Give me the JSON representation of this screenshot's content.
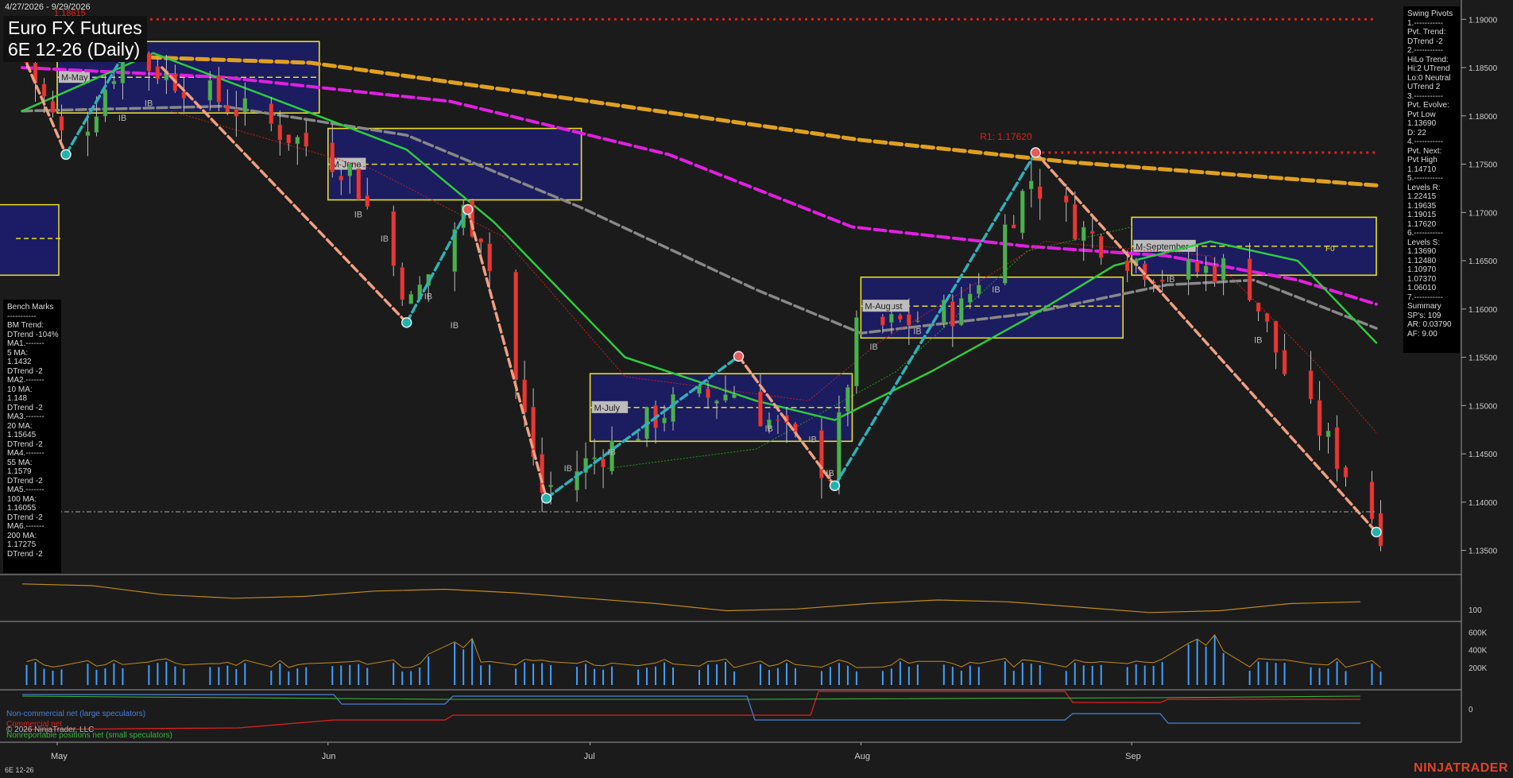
{
  "header": {
    "date_range": "4/27/2026 - 9/29/2026",
    "title": "Euro FX Futures",
    "subtitle": "6E 12-26 (Daily)",
    "old_level_label": "1.18615"
  },
  "bench_marks": [
    "Bench Marks",
    "-----------",
    "BM Trend:",
    "DTrend -104%",
    "MA1.-------",
    "5 MA:",
    "1.1432",
    "DTrend -2",
    "MA2.-------",
    "10 MA:",
    "1.148",
    "DTrend -2",
    "MA3.-------",
    "20 MA:",
    "1.15645",
    "DTrend -2",
    "MA4.-------",
    "55 MA:",
    "1.1579",
    "DTrend -2",
    "MA5.-------",
    "100 MA:",
    "1.16055",
    "DTrend -2",
    "MA6.-------",
    "200 MA:",
    "1.17275",
    "DTrend -2"
  ],
  "swing_pivots": [
    "Swing Pivots",
    "1.-----------",
    "Pvt. Trend:",
    "DTrend -2",
    "2.-----------",
    "HiLo Trend:",
    "Hi:2 UTrend",
    "Lo:0 Neutral",
    "UTrend 2",
    "3.-----------",
    "Pvt. Evolve:",
    "Pvt Low",
    "1.13690",
    "D: 22",
    "4.-----------",
    "Pvt. Next:",
    "Pvt High",
    "1.14710",
    "5.-----------",
    "Levels R:",
    "1.22415",
    "1.19635",
    "1.19015",
    "1.17620",
    "6.-----------",
    "Levels S:",
    "1.13690",
    "1.12480",
    "1.10970",
    "1.07370",
    "1.06010",
    "7.-----------",
    "Summary",
    "SP's: 109",
    "AR: 0.03790",
    "AF: 9.00"
  ],
  "legend": {
    "noncommercial": "Non-commercial net (large speculators)",
    "commercial": "Commercial net",
    "copyright": "© 2026 NinjaTrader, LLC",
    "nonreportable": "Nonreportable positions net (small speculators)"
  },
  "footer": {
    "symbol": "6E 12-26",
    "brand": "NINJATRADER"
  },
  "colors": {
    "background": "#1b1b1b",
    "up_candle": "#4caf50",
    "down_candle": "#e53935",
    "ma_fast": "#2ecc40",
    "ma_mid": "#888888",
    "ma_magenta": "#e020e0",
    "ma_slow": "#e0a020",
    "swing_up": "#30b0b8",
    "swing_down": "#f0a080",
    "resistance": "#e02020",
    "volume": "#3ea0ff",
    "noncommercial": "#4a7fd8",
    "commercial": "#e02020",
    "nonreportable": "#3cb43c"
  },
  "chart_data": {
    "type": "candlestick",
    "x_axis_labels": [
      "May",
      "Jun",
      "Jul",
      "Aug",
      "Sep"
    ],
    "x_axis_label_dates": [
      "2026-05-01",
      "2026-06-01",
      "2026-07-01",
      "2026-08-01",
      "2026-09-01"
    ],
    "date_start": "2026-04-27",
    "date_end": "2026-09-29",
    "price_axis": {
      "min": 1.1325,
      "max": 1.192,
      "ticks": [
        1.19,
        1.185,
        1.18,
        1.175,
        1.17,
        1.165,
        1.16,
        1.155,
        1.15,
        1.145,
        1.14,
        1.135
      ]
    },
    "price_keypoints": [
      {
        "date": "2026-04-27",
        "price": 1.1855
      },
      {
        "date": "2026-05-02",
        "price": 1.176
      },
      {
        "date": "2026-05-08",
        "price": 1.1865
      },
      {
        "date": "2026-05-25",
        "price": 1.179
      },
      {
        "date": "2026-06-03",
        "price": 1.1745
      },
      {
        "date": "2026-06-10",
        "price": 1.1605
      },
      {
        "date": "2026-06-16",
        "price": 1.17
      },
      {
        "date": "2026-06-18",
        "price": 1.168
      },
      {
        "date": "2026-06-25",
        "price": 1.141
      },
      {
        "date": "2026-07-10",
        "price": 1.15
      },
      {
        "date": "2026-07-17",
        "price": 1.1515
      },
      {
        "date": "2026-07-28",
        "price": 1.143
      },
      {
        "date": "2026-07-31",
        "price": 1.1575
      },
      {
        "date": "2026-08-12",
        "price": 1.16
      },
      {
        "date": "2026-08-20",
        "price": 1.1735
      },
      {
        "date": "2026-08-26",
        "price": 1.168
      },
      {
        "date": "2026-09-04",
        "price": 1.1635
      },
      {
        "date": "2026-09-13",
        "price": 1.1645
      },
      {
        "date": "2026-09-18",
        "price": 1.1535
      },
      {
        "date": "2026-09-29",
        "price": 1.1372
      }
    ],
    "moving_averages": [
      {
        "name": "ma_fast",
        "points": [
          [
            "2026-04-27",
            1.1805
          ],
          [
            "2026-05-12",
            1.1865
          ],
          [
            "2026-05-28",
            1.181
          ],
          [
            "2026-06-10",
            1.1765
          ],
          [
            "2026-06-20",
            1.169
          ],
          [
            "2026-07-05",
            1.155
          ],
          [
            "2026-07-20",
            1.1505
          ],
          [
            "2026-07-29",
            1.1485
          ],
          [
            "2026-08-09",
            1.1535
          ],
          [
            "2026-08-20",
            1.159
          ],
          [
            "2026-08-30",
            1.1645
          ],
          [
            "2026-09-10",
            1.167
          ],
          [
            "2026-09-20",
            1.165
          ],
          [
            "2026-09-29",
            1.1565
          ]
        ]
      },
      {
        "name": "ma_mid",
        "points": [
          [
            "2026-04-27",
            1.1805
          ],
          [
            "2026-05-20",
            1.181
          ],
          [
            "2026-06-10",
            1.178
          ],
          [
            "2026-06-30",
            1.1705
          ],
          [
            "2026-07-20",
            1.162
          ],
          [
            "2026-08-01",
            1.1575
          ],
          [
            "2026-08-20",
            1.1595
          ],
          [
            "2026-09-05",
            1.1625
          ],
          [
            "2026-09-15",
            1.163
          ],
          [
            "2026-09-29",
            1.158
          ]
        ]
      },
      {
        "name": "ma_magenta",
        "points": [
          [
            "2026-04-27",
            1.185
          ],
          [
            "2026-05-20",
            1.184
          ],
          [
            "2026-06-15",
            1.1815
          ],
          [
            "2026-07-10",
            1.176
          ],
          [
            "2026-07-31",
            1.1685
          ],
          [
            "2026-08-20",
            1.1665
          ],
          [
            "2026-09-05",
            1.1655
          ],
          [
            "2026-09-20",
            1.163
          ],
          [
            "2026-09-29",
            1.1605
          ]
        ]
      },
      {
        "name": "ma_slow",
        "points": [
          [
            "2026-04-27",
            1.1865
          ],
          [
            "2026-05-30",
            1.1855
          ],
          [
            "2026-07-01",
            1.1815
          ],
          [
            "2026-08-01",
            1.1775
          ],
          [
            "2026-08-25",
            1.1752
          ],
          [
            "2026-09-29",
            1.1728
          ]
        ]
      }
    ],
    "swing_lines": [
      {
        "dir": "down",
        "from": [
          "2026-04-27",
          1.1865
        ],
        "to": [
          "2026-05-02",
          1.176
        ]
      },
      {
        "dir": "up",
        "from": [
          "2026-05-02",
          1.176
        ],
        "to": [
          "2026-05-09",
          1.187
        ]
      },
      {
        "dir": "down",
        "from": [
          "2026-05-13",
          1.185
        ],
        "to": [
          "2026-06-10",
          1.1586
        ]
      },
      {
        "dir": "up",
        "from": [
          "2026-06-10",
          1.1586
        ],
        "to": [
          "2026-06-17",
          1.1703
        ]
      },
      {
        "dir": "down",
        "from": [
          "2026-06-17",
          1.1703
        ],
        "to": [
          "2026-06-26",
          1.1404
        ]
      },
      {
        "dir": "up",
        "from": [
          "2026-06-26",
          1.1404
        ],
        "to": [
          "2026-07-18",
          1.1551
        ]
      },
      {
        "dir": "down",
        "from": [
          "2026-07-18",
          1.1551
        ],
        "to": [
          "2026-07-29",
          1.1417
        ]
      },
      {
        "dir": "up",
        "from": [
          "2026-07-29",
          1.1417
        ],
        "to": [
          "2026-08-21",
          1.1762
        ]
      },
      {
        "dir": "down",
        "from": [
          "2026-08-21",
          1.1762
        ],
        "to": [
          "2026-09-29",
          1.1369
        ]
      }
    ],
    "pivot_markers": [
      {
        "date": "2026-05-02",
        "price": 1.176,
        "type": "low"
      },
      {
        "date": "2026-06-10",
        "price": 1.1586,
        "type": "low"
      },
      {
        "date": "2026-06-17",
        "price": 1.1703,
        "type": "high"
      },
      {
        "date": "2026-06-26",
        "price": 1.1404,
        "type": "low"
      },
      {
        "date": "2026-07-18",
        "price": 1.1551,
        "type": "high"
      },
      {
        "date": "2026-07-29",
        "price": 1.1417,
        "type": "low"
      },
      {
        "date": "2026-08-21",
        "price": 1.1762,
        "type": "high"
      },
      {
        "date": "2026-09-29",
        "price": 1.1369,
        "type": "low"
      }
    ],
    "resistance_lines": [
      {
        "price": 1.19,
        "from": "2026-05-08",
        "to": "2026-09-29"
      },
      {
        "price": 1.1762,
        "from": "2026-08-21",
        "to": "2026-09-29",
        "label": "R1: 1.17620"
      }
    ],
    "support_line": {
      "price": 1.139,
      "from": "2026-04-28",
      "to": "2026-09-29"
    },
    "monthly_boxes": [
      {
        "label": "M-May",
        "from": "2026-05-01",
        "to": "2026-05-31",
        "high": 1.1877,
        "low": 1.1803,
        "mid": 1.184
      },
      {
        "label": "M-June",
        "from": "2026-06-01",
        "to": "2026-06-30",
        "high": 1.1787,
        "low": 1.1713,
        "mid": 1.175
      },
      {
        "label": "M-July",
        "from": "2026-07-01",
        "to": "2026-07-31",
        "high": 1.1533,
        "low": 1.1463,
        "mid": 1.1498
      },
      {
        "label": "M-August",
        "from": "2026-08-01",
        "to": "2026-08-31",
        "high": 1.1633,
        "low": 1.157,
        "mid": 1.1603
      },
      {
        "label": "M-September",
        "from": "2026-09-01",
        "to": "2026-09-29",
        "high": 1.1695,
        "low": 1.1635,
        "mid": 1.1665,
        "extra": "F0"
      }
    ],
    "ib_labels": [
      [
        "2026-05-08",
        1.1795
      ],
      [
        "2026-05-11",
        1.181
      ],
      [
        "2026-06-04",
        1.1695
      ],
      [
        "2026-06-07",
        1.167
      ],
      [
        "2026-06-12",
        1.161
      ],
      [
        "2026-06-15",
        1.158
      ],
      [
        "2026-06-28",
        1.1432
      ],
      [
        "2026-07-03",
        1.1449
      ],
      [
        "2026-07-21",
        1.1473
      ],
      [
        "2026-07-26",
        1.1462
      ],
      [
        "2026-07-28",
        1.1427
      ],
      [
        "2026-08-02",
        1.1558
      ],
      [
        "2026-08-07",
        1.1574
      ],
      [
        "2026-08-16",
        1.1617
      ],
      [
        "2026-09-05",
        1.1628
      ],
      [
        "2026-09-15",
        1.1565
      ]
    ],
    "indicator_panel": {
      "label": "100",
      "values": [
        0.85,
        0.8,
        0.55,
        0.45,
        0.5,
        0.65,
        0.7,
        0.6,
        0.45,
        0.3,
        0.1,
        0.15,
        0.3,
        0.4,
        0.35,
        0.2,
        0.05,
        0.1,
        0.3,
        0.35
      ]
    },
    "volume_panel": {
      "ticks": [
        "600K",
        "400K",
        "200K"
      ],
      "max": 650000
    },
    "cot_panel": {
      "tick": "0"
    }
  }
}
